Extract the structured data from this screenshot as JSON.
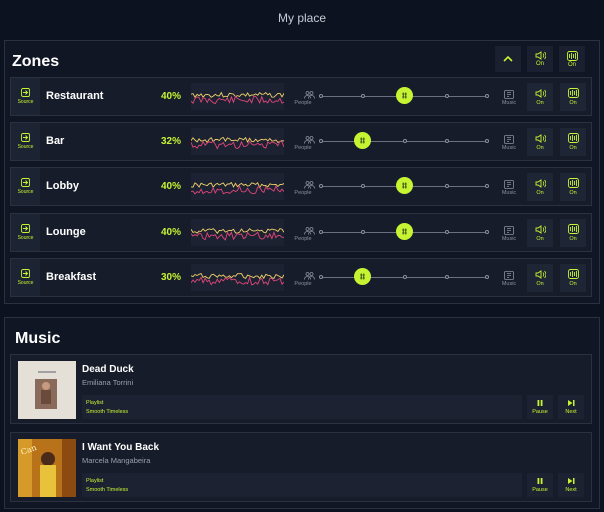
{
  "page": {
    "title": "My place"
  },
  "zones_panel": {
    "title": "Zones",
    "header_buttons": [
      {
        "icon": "chevron-up-icon"
      },
      {
        "icon": "speaker-icon",
        "label": "On"
      },
      {
        "icon": "waveform-icon",
        "label": "On"
      }
    ]
  },
  "zones": [
    {
      "source_label": "Source",
      "name": "Restaurant",
      "percent": "40%",
      "level": 0.5,
      "people_label": "People",
      "music_label": "Music",
      "sound_label": "On",
      "wave_label": "On"
    },
    {
      "source_label": "Source",
      "name": "Bar",
      "percent": "32%",
      "level": 0.25,
      "people_label": "People",
      "music_label": "Music",
      "sound_label": "On",
      "wave_label": "On"
    },
    {
      "source_label": "Source",
      "name": "Lobby",
      "percent": "40%",
      "level": 0.5,
      "people_label": "People",
      "music_label": "Music",
      "sound_label": "On",
      "wave_label": "On"
    },
    {
      "source_label": "Source",
      "name": "Lounge",
      "percent": "40%",
      "level": 0.5,
      "people_label": "People",
      "music_label": "Music",
      "sound_label": "On",
      "wave_label": "On"
    },
    {
      "source_label": "Source",
      "name": "Breakfast",
      "percent": "30%",
      "level": 0.25,
      "people_label": "People",
      "music_label": "Music",
      "sound_label": "On",
      "wave_label": "On"
    }
  ],
  "music_panel": {
    "title": "Music"
  },
  "tracks": [
    {
      "name": "Dead Duck",
      "artist": "Emiliana Torrini",
      "playlist_label": "Playlist",
      "playlist_name": "Smooth Timeless",
      "pause_label": "Pause",
      "next_label": "Next"
    },
    {
      "name": "I Want You Back",
      "artist": "Marcela Mangabeira",
      "playlist_label": "Playlist",
      "playlist_name": "Smooth Timeless",
      "pause_label": "Pause",
      "next_label": "Next"
    }
  ],
  "colors": {
    "accent": "#c6f432",
    "line_red": "#e0467a",
    "line_yellow": "#f2d26a",
    "background": "#0d1220"
  }
}
